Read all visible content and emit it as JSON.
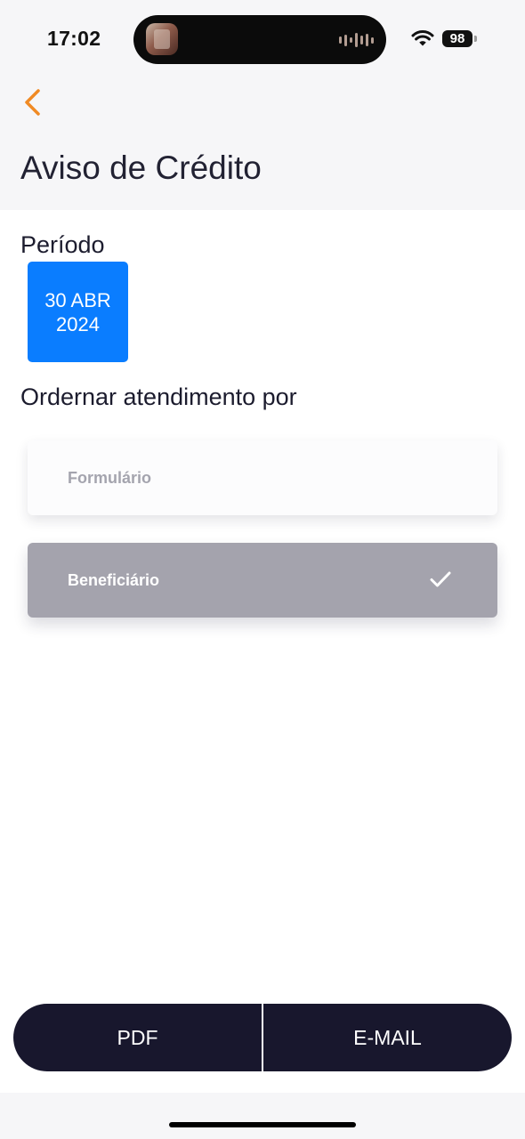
{
  "status_bar": {
    "time": "17:02",
    "battery_level": "98",
    "icons": [
      "wifi-icon",
      "battery-icon",
      "audio-waveform-icon"
    ]
  },
  "header": {
    "back_icon": "chevron-left-icon",
    "title": "Aviso de Crédito"
  },
  "period": {
    "label": "Período",
    "date_day_month": "30 ABR",
    "date_year": "2024"
  },
  "ordering": {
    "label": "Ordernar atendimento por",
    "options": [
      {
        "label": "Formulário",
        "selected": false
      },
      {
        "label": "Beneficiário",
        "selected": true
      }
    ]
  },
  "actions": {
    "pdf_label": "PDF",
    "email_label": "E-MAIL"
  },
  "colors": {
    "accent_orange": "#f08a24",
    "date_blue": "#0a7dff",
    "dark_navy": "#18172d",
    "selected_gray": "#a4a3ad",
    "header_bg": "#f6f6f8"
  }
}
